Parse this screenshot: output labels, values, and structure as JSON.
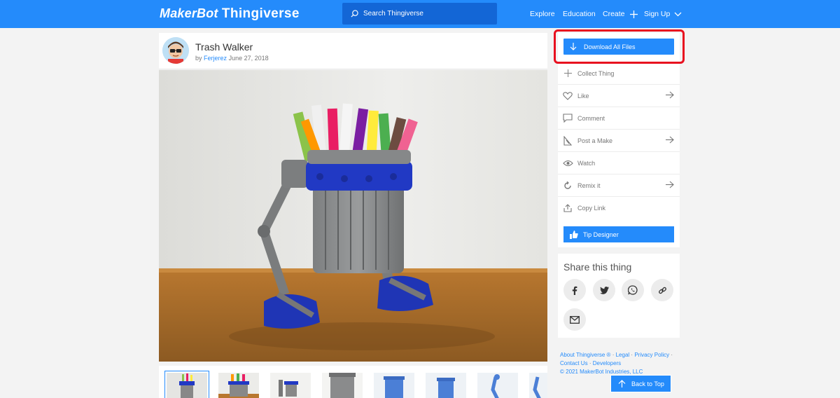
{
  "header": {
    "logo_maker": "MakerBot",
    "logo_thing": "Thingiverse",
    "search_placeholder": "Search Thingiverse",
    "nav": {
      "explore": "Explore",
      "education": "Education",
      "create": "Create",
      "signup": "Sign Up"
    }
  },
  "thing": {
    "title": "Trash Walker",
    "by": "by",
    "author": "Ferjerez",
    "date": "June 27, 2018"
  },
  "sidebar": {
    "download_label": "Download All Files",
    "actions": [
      {
        "label": "Collect Thing",
        "icon": "plus-icon",
        "arrow": false
      },
      {
        "label": "Like",
        "icon": "heart-icon",
        "arrow": true
      },
      {
        "label": "Comment",
        "icon": "comment-icon",
        "arrow": false
      },
      {
        "label": "Post a Make",
        "icon": "make-icon",
        "arrow": true
      },
      {
        "label": "Watch",
        "icon": "eye-icon",
        "arrow": false
      },
      {
        "label": "Remix it",
        "icon": "remix-icon",
        "arrow": true
      },
      {
        "label": "Copy Link",
        "icon": "share-icon",
        "arrow": false
      }
    ],
    "tip_label": "Tip Designer"
  },
  "share": {
    "title": "Share this thing",
    "buttons": [
      "facebook-icon",
      "twitter-icon",
      "whatsapp-icon",
      "link-icon",
      "email-icon"
    ]
  },
  "footer": {
    "about": "About Thingiverse ®",
    "legal": "Legal",
    "privacy": "Privacy Policy",
    "contact": "Contact Us",
    "developers": "Developers",
    "copyright": "©  2021 MakerBot Industries, LLC"
  },
  "back_to_top": "Back to Top",
  "colors": {
    "brand": "#248bfb",
    "highlight": "#e8101f",
    "header_search": "#1366d6"
  }
}
